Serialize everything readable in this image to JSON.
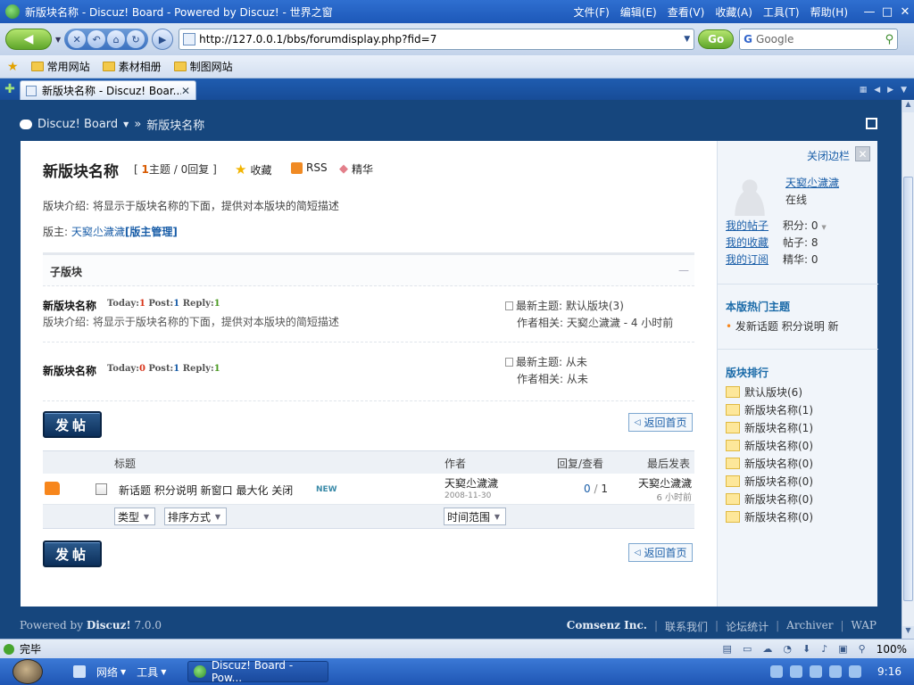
{
  "window": {
    "title": "新版块名称 - Discuz! Board - Powered by Discuz! - 世界之窗",
    "menus": [
      "文件(F)",
      "编辑(E)",
      "查看(V)",
      "收藏(A)",
      "工具(T)",
      "帮助(H)"
    ],
    "controls": {
      "minimize": "—",
      "restore": "□",
      "close": "✕"
    }
  },
  "navbar": {
    "url": "http://127.0.0.1/bbs/forumdisplay.php?fid=7",
    "go_label": "Go",
    "search_placeholder": "Google"
  },
  "bookmarks": [
    "常用网站",
    "素材相册",
    "制图网站"
  ],
  "tabs": [
    {
      "label": "新版块名称 - Discuz! Boar..."
    }
  ],
  "breadcrumb": {
    "root": "Discuz! Board",
    "sep": "»",
    "current": "新版块名称"
  },
  "forum": {
    "title": "新版块名称",
    "stats": {
      "open": "[",
      "topics": "1",
      "topics_label": "主题",
      "slash": "/",
      "replies": "0",
      "replies_label": "回复",
      "close": "]"
    },
    "actions": {
      "favorite": "收藏",
      "rss": "RSS",
      "digest": "精华"
    },
    "intro": "版块介绍: 将显示于版块名称的下面，提供对本版块的简短描述",
    "moderators_label": "版主:",
    "moderator": "天窫尐濊濊",
    "manage_link": "[版主管理]"
  },
  "subforums": {
    "header": "子版块",
    "collapse": "—",
    "items": [
      {
        "name": "新版块名称",
        "today_label": "Today:",
        "today": "1",
        "post_label": "Post:",
        "post": "1",
        "reply_label": "Reply:",
        "reply": "1",
        "desc": "版块介绍: 将显示于版块名称的下面，提供对本版块的简短描述",
        "last_topic_label": "最新主题:",
        "last_topic": "默认版块(3)",
        "last_author_label": "作者相关:",
        "last_author": "天窫尐濊濊",
        "last_time": " - 4 小时前"
      },
      {
        "name": "新版块名称",
        "today_label": "Today:",
        "today": "0",
        "post_label": "Post:",
        "post": "1",
        "reply_label": "Reply:",
        "reply": "1",
        "desc": "",
        "last_topic_label": "最新主题:",
        "last_topic": "从未",
        "last_author_label": "作者相关:",
        "last_author": "从未",
        "last_time": ""
      }
    ]
  },
  "buttons": {
    "post": "发帖",
    "back_home": "返回首页"
  },
  "thread_table": {
    "headers": {
      "title": "标题",
      "author": "作者",
      "replies_views": "回复/查看",
      "last_post": "最后发表"
    },
    "rows": [
      {
        "title": "新话题 积分说明 新窗口 最大化 关闭",
        "new_tag": "NEW",
        "author": "天窫尐濊濊",
        "date": "2008-11-30",
        "replies": "0",
        "sep": "/",
        "views": "1",
        "last_by": "天窫尐濊濊",
        "last_time": "6 小时前"
      }
    ],
    "filters": {
      "type": "类型",
      "sort": "排序方式",
      "time": "时间范围"
    }
  },
  "sidebar": {
    "close_label": "关闭边栏",
    "close_x": "✕",
    "user": {
      "name": "天窫尐濊濊",
      "status": "在线"
    },
    "links": [
      "我的帖子",
      "我的收藏",
      "我的订阅"
    ],
    "stats": [
      "积分: 0",
      "帖子: 8",
      "精华: 0"
    ],
    "hot_title": "本版热门主题",
    "hot_item": "发新话题 积分说明 新",
    "rank_title": "版块排行",
    "ranks": [
      "默认版块(6)",
      "新版块名称(1)",
      "新版块名称(1)",
      "新版块名称(0)",
      "新版块名称(0)",
      "新版块名称(0)",
      "新版块名称(0)",
      "新版块名称(0)"
    ]
  },
  "footer": {
    "powered_prefix": "Powered by",
    "brand": "Discuz!",
    "version": "7.0.0",
    "company": "Comsenz Inc.",
    "links": [
      "联系我们",
      "论坛统计",
      "Archiver",
      "WAP"
    ]
  },
  "statusbar": {
    "status": "完毕",
    "zoom": "100%"
  },
  "taskbar": {
    "network": "网络",
    "tools": "工具",
    "window": "Discuz! Board - Pow...",
    "clock": "9:16"
  }
}
